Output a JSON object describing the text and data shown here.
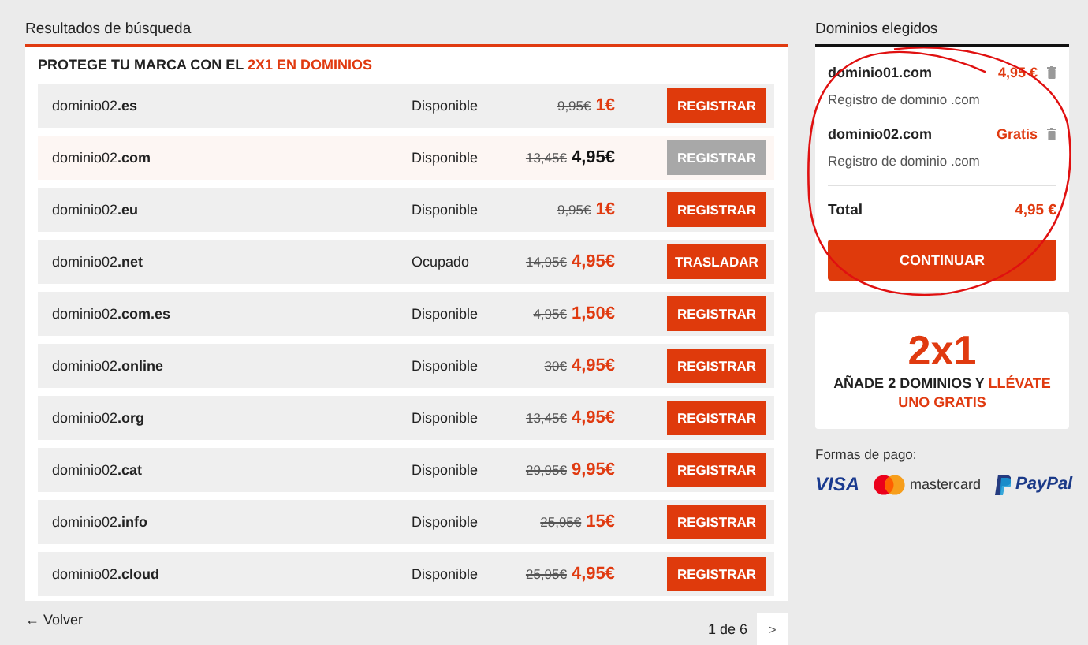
{
  "results": {
    "title": "Resultados de búsqueda",
    "promo_heading": "PROTEGE TU MARCA CON EL **2X1 EN DOMINIOS**",
    "rows": [
      {
        "domain": "dominio02**.es**",
        "status": "Disponible",
        "old_price": "9,95€",
        "price": "1€",
        "action": "REGISTRAR",
        "selected": false
      },
      {
        "domain": "dominio02**.com**",
        "status": "Disponible",
        "old_price": "13,45€",
        "price": "4,95€",
        "action": "REGISTRAR",
        "selected": true
      },
      {
        "domain": "dominio02**.eu**",
        "status": "Disponible",
        "old_price": "9,95€",
        "price": "1€",
        "action": "REGISTRAR",
        "selected": false
      },
      {
        "domain": "dominio02**.net**",
        "status": "Ocupado",
        "old_price": "14,95€",
        "price": "4,95€",
        "action": "TRASLADAR",
        "selected": false
      },
      {
        "domain": "dominio02**.com.es**",
        "status": "Disponible",
        "old_price": "4,95€",
        "price": "1,50€",
        "action": "REGISTRAR",
        "selected": false
      },
      {
        "domain": "dominio02**.online**",
        "status": "Disponible",
        "old_price": "30€",
        "price": "4,95€",
        "action": "REGISTRAR",
        "selected": false
      },
      {
        "domain": "dominio02**.org**",
        "status": "Disponible",
        "old_price": "13,45€",
        "price": "4,95€",
        "action": "REGISTRAR",
        "selected": false
      },
      {
        "domain": "dominio02**.cat**",
        "status": "Disponible",
        "old_price": "29,95€",
        "price": "9,95€",
        "action": "REGISTRAR",
        "selected": false
      },
      {
        "domain": "dominio02**.info**",
        "status": "Disponible",
        "old_price": "25,95€",
        "price": "15€",
        "action": "REGISTRAR",
        "selected": false
      },
      {
        "domain": "dominio02**.cloud**",
        "status": "Disponible",
        "old_price": "25,95€",
        "price": "4,95€",
        "action": "REGISTRAR",
        "selected": false
      }
    ],
    "back_link": "← Volver",
    "pagination": {
      "label": "1 de 6",
      "next": ">"
    }
  },
  "cart": {
    "title": "Dominios elegidos",
    "items": [
      {
        "name": "dominio01.com",
        "price": "4,95 €",
        "description": "Registro de dominio .com"
      },
      {
        "name": "dominio02.com",
        "price": "Gratis",
        "description": "Registro de dominio .com"
      }
    ],
    "total_label": "Total",
    "total": "4,95 €",
    "button": "CONTINUAR"
  },
  "promo": {
    "headline": "2x1",
    "text": "AÑADE 2 DOMINIOS Y **LLÉVATE UNO GRATIS**"
  },
  "payment": {
    "label": "Formas de pago:",
    "methods": [
      {
        "kind": "visa",
        "label": "VISA"
      },
      {
        "kind": "mastercard",
        "label": "mastercard"
      },
      {
        "kind": "paypal",
        "label": "PayPal"
      }
    ]
  }
}
